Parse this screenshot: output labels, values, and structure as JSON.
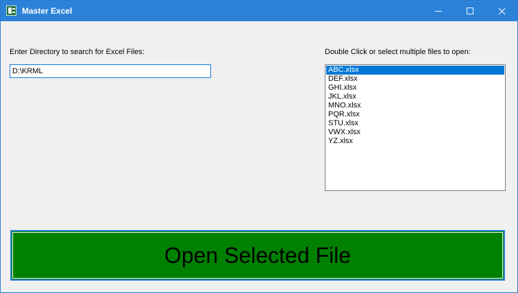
{
  "window": {
    "title": "Master Excel",
    "icon": "excel-icon"
  },
  "titlebar_controls": {
    "minimize": "minimize-icon",
    "maximize": "maximize-icon",
    "close": "close-icon"
  },
  "directory": {
    "label": "Enter Directory to search for Excel Files:",
    "value": "D:\\KRML"
  },
  "files": {
    "label": "Double Click or select multiple files to open:",
    "items": [
      "ABC.xlsx",
      "DEF.xlsx",
      "GHI.xlsx",
      "JKL.xlsx",
      "MNO.xlsx",
      "PQR.xlsx",
      "STU.xlsx",
      "VWX.xlsx",
      "YZ.xlsx"
    ],
    "selected_index": 0
  },
  "open_button": {
    "label": "Open Selected File",
    "color": "#008000"
  },
  "colors": {
    "titlebar": "#2b82d8",
    "selection": "#0078d7",
    "window_bg": "#f0f0f0"
  }
}
